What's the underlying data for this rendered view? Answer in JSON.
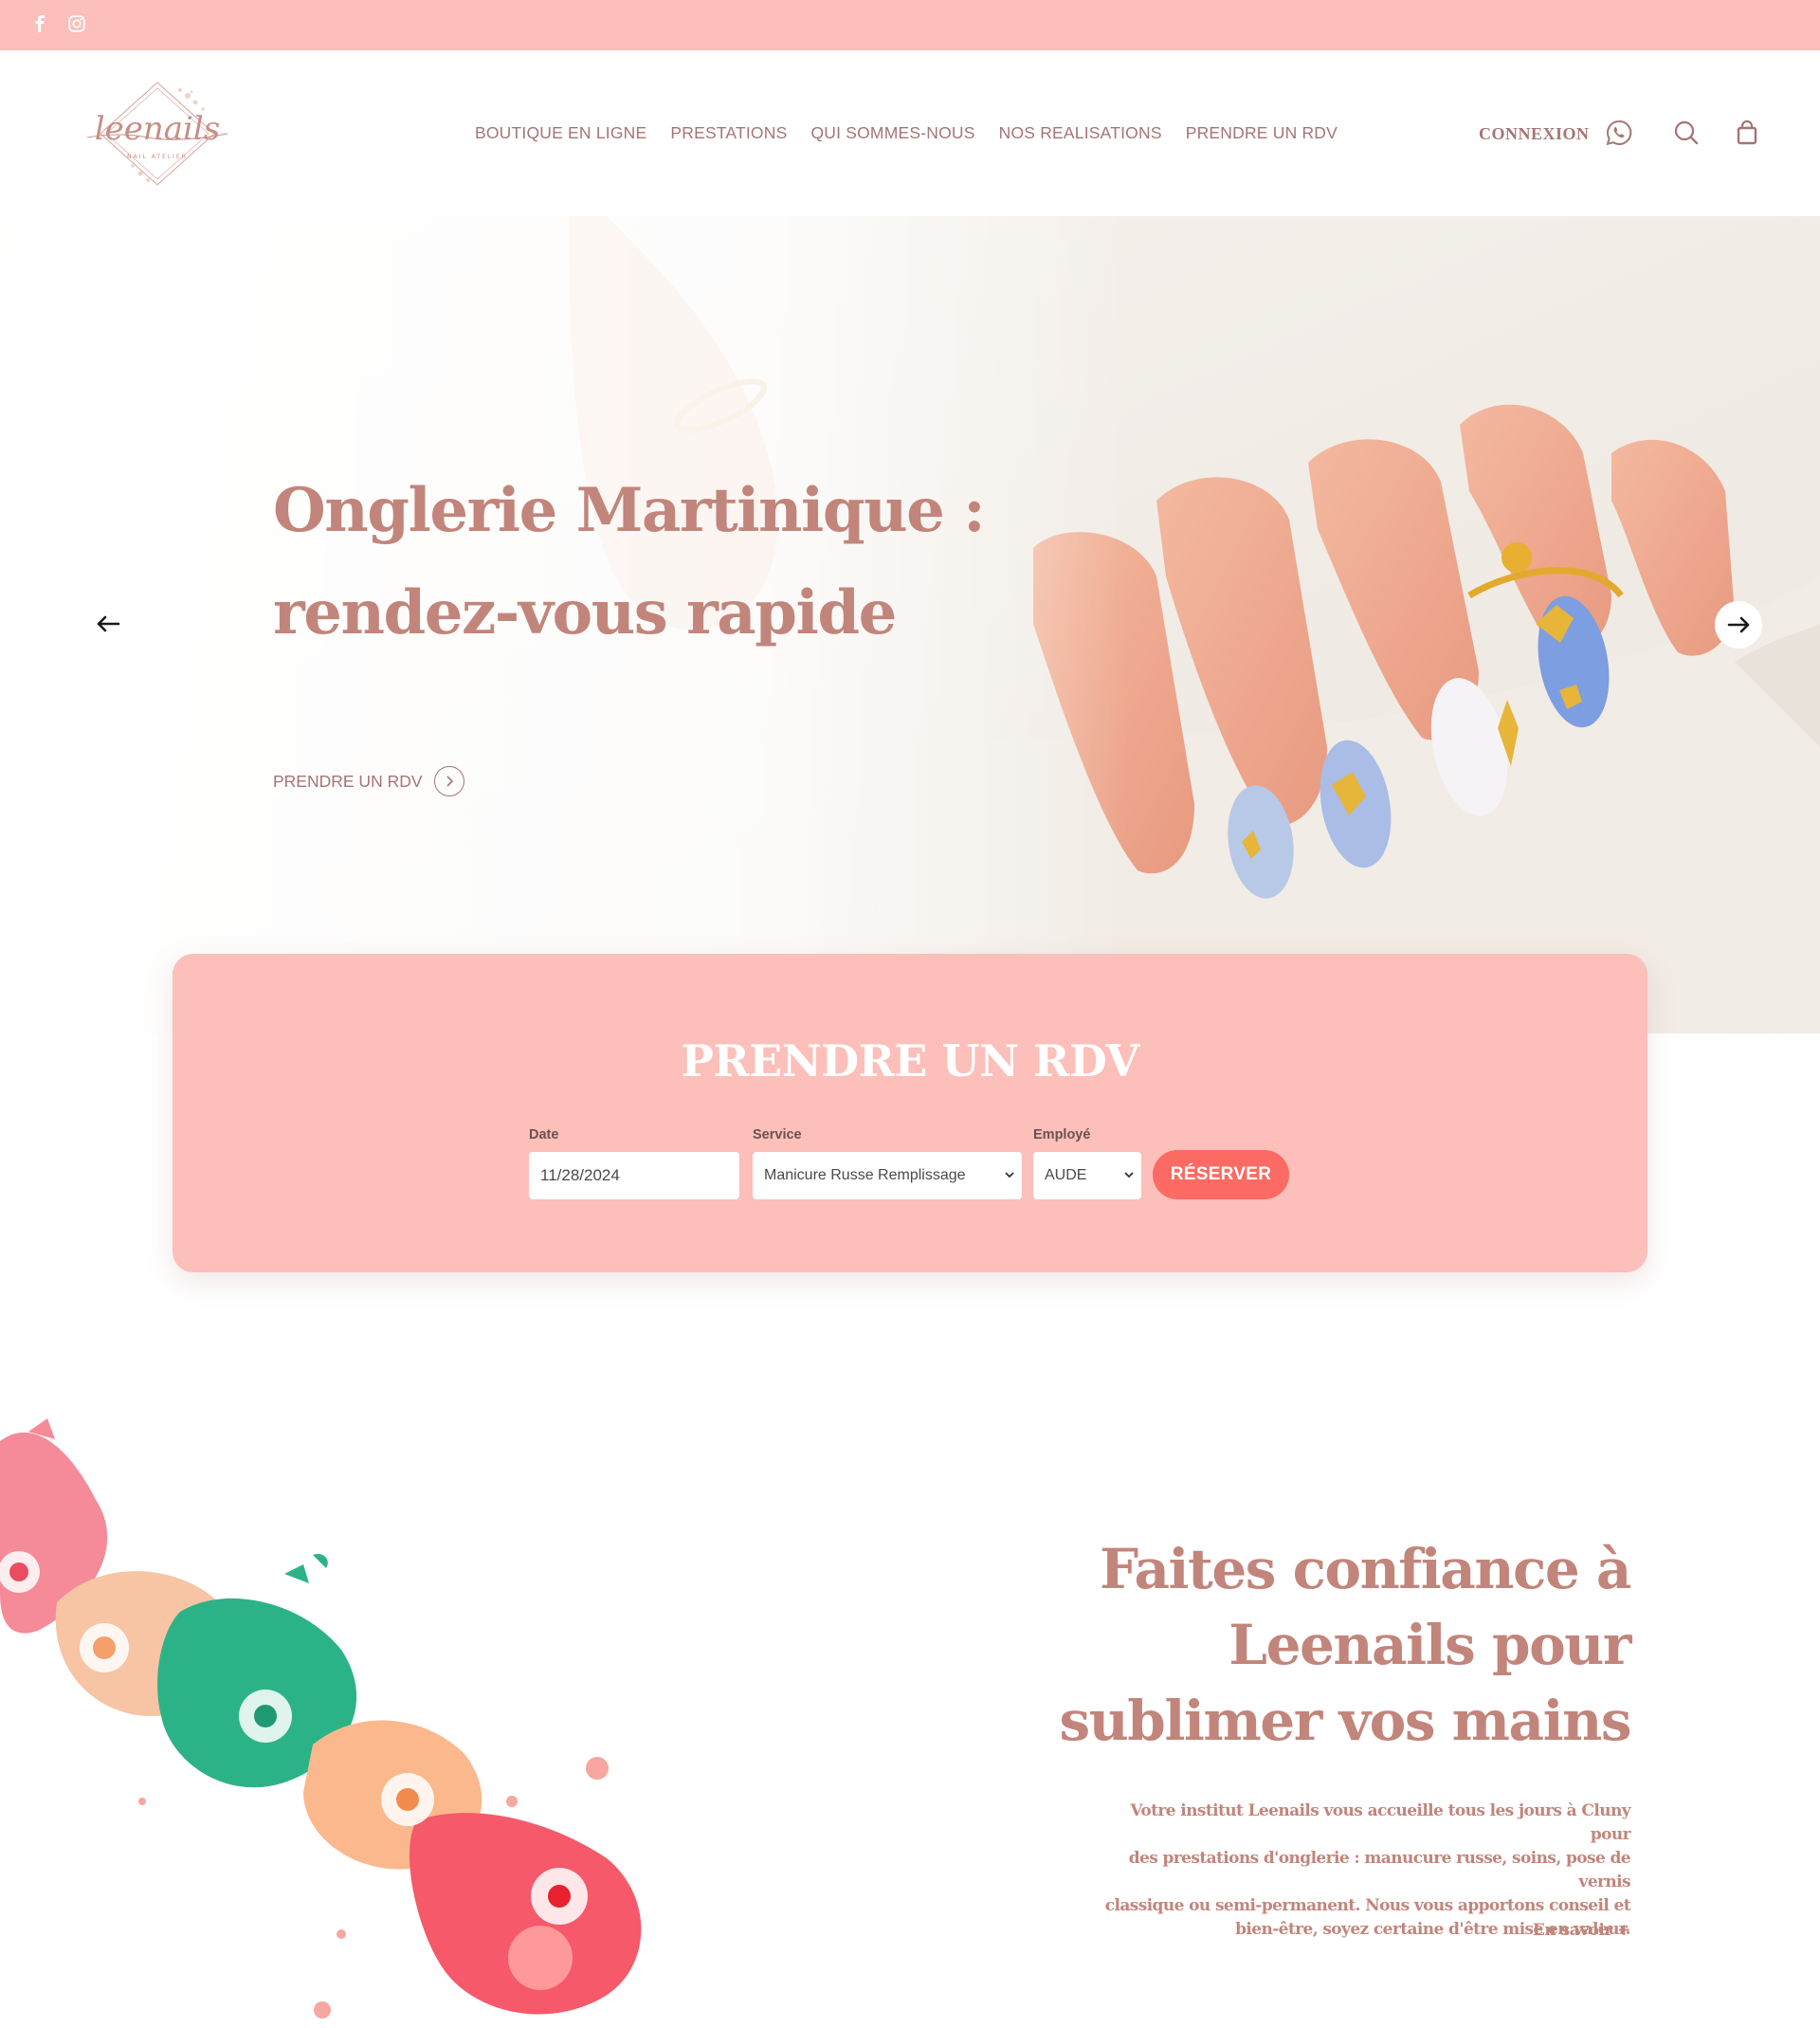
{
  "colors": {
    "accent": "#fcbfb9",
    "text_rose": "#c2857b",
    "nav_text": "#a47575",
    "button": "#fb6b63"
  },
  "topbar": {
    "social": [
      "facebook-icon",
      "instagram-icon"
    ]
  },
  "header": {
    "logo_text": "leenails",
    "logo_subtitle": "NAIL ATELIER",
    "nav": [
      "BOUTIQUE EN LIGNE",
      "PRESTATIONS",
      "QUI SOMMES-NOUS",
      "NOS REALISATIONS",
      "PRENDRE UN RDV"
    ],
    "connexion": "CONNEXION",
    "icons": [
      "whatsapp-icon",
      "search-icon",
      "shopping-bag-icon"
    ]
  },
  "hero": {
    "title_line1": "Onglerie Martinique :",
    "title_line2": "rendez-vous rapide",
    "cta": "PRENDRE UN RDV"
  },
  "booking": {
    "title": "PRENDRE UN RDV",
    "date_label": "Date",
    "date_value": "11/28/2024",
    "service_label": "Service",
    "service_value": "Manicure Russe Remplissage",
    "employee_label": "Employé",
    "employee_value": "AUDE",
    "reserve": "RÉSERVER"
  },
  "about": {
    "title_line1": "Faites confiance à",
    "title_line2": "Leenails pour",
    "title_line3": "sublimer vos mains",
    "text_line1": "Votre institut Leenails vous accueille tous les jours à Cluny pour",
    "text_line2": "des prestations d'onglerie : manucure russe, soins, pose de vernis",
    "text_line3": "classique ou semi-permanent. Nous vous apportons conseil et",
    "text_line4": "bien-être, soyez certaine d'être mise en valeur.",
    "link": "En savoir +"
  }
}
